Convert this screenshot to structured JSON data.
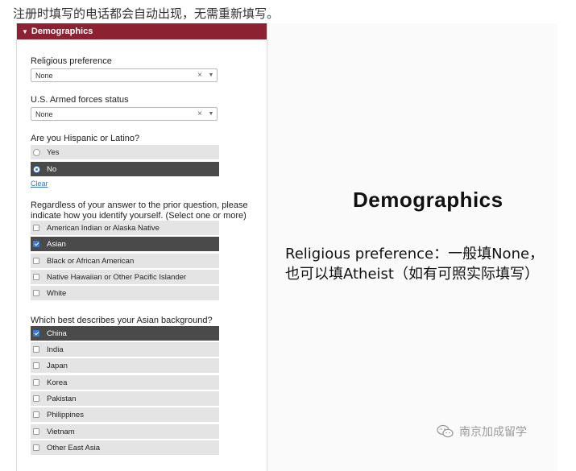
{
  "top_note": "注册时填写的电话都会自动出现，无需重新填写。",
  "section": {
    "title": "Demographics"
  },
  "religious": {
    "label": "Religious preference",
    "value": "None"
  },
  "armed": {
    "label": "U.S. Armed forces status",
    "value": "None"
  },
  "hispanic": {
    "label": "Are you Hispanic or Latino?",
    "options": [
      {
        "label": "Yes",
        "selected": false
      },
      {
        "label": "No",
        "selected": true
      }
    ],
    "clear_label": "Clear"
  },
  "race": {
    "label_line1": "Regardless of your answer to the prior question, please",
    "label_line2": "indicate how you identify yourself. (Select one or more)",
    "options": [
      {
        "label": "American Indian or Alaska Native",
        "selected": false
      },
      {
        "label": "Asian",
        "selected": true
      },
      {
        "label": "Black or African American",
        "selected": false
      },
      {
        "label": "Native Hawaiian or Other Pacific Islander",
        "selected": false
      },
      {
        "label": "White",
        "selected": false
      }
    ]
  },
  "asian": {
    "label": "Which best describes your Asian background?",
    "options": [
      {
        "label": "China",
        "selected": true
      },
      {
        "label": "India",
        "selected": false
      },
      {
        "label": "Japan",
        "selected": false
      },
      {
        "label": "Korea",
        "selected": false
      },
      {
        "label": "Pakistan",
        "selected": false
      },
      {
        "label": "Philippines",
        "selected": false
      },
      {
        "label": "Vietnam",
        "selected": false
      },
      {
        "label": "Other East Asia",
        "selected": false
      }
    ]
  },
  "explanation": {
    "title": "Demographics",
    "line1": "Religious preference：一般填None，",
    "line2": "也可以填Atheist（如有可照实际填写）"
  },
  "watermark": {
    "text": "南京加成留学",
    "icon": "wechat-icon"
  },
  "colors": {
    "header_bg": "#8b2131",
    "selected_bg": "#4a4a4a",
    "option_bg": "#e4e4e4",
    "accent": "#3a7bd5"
  }
}
